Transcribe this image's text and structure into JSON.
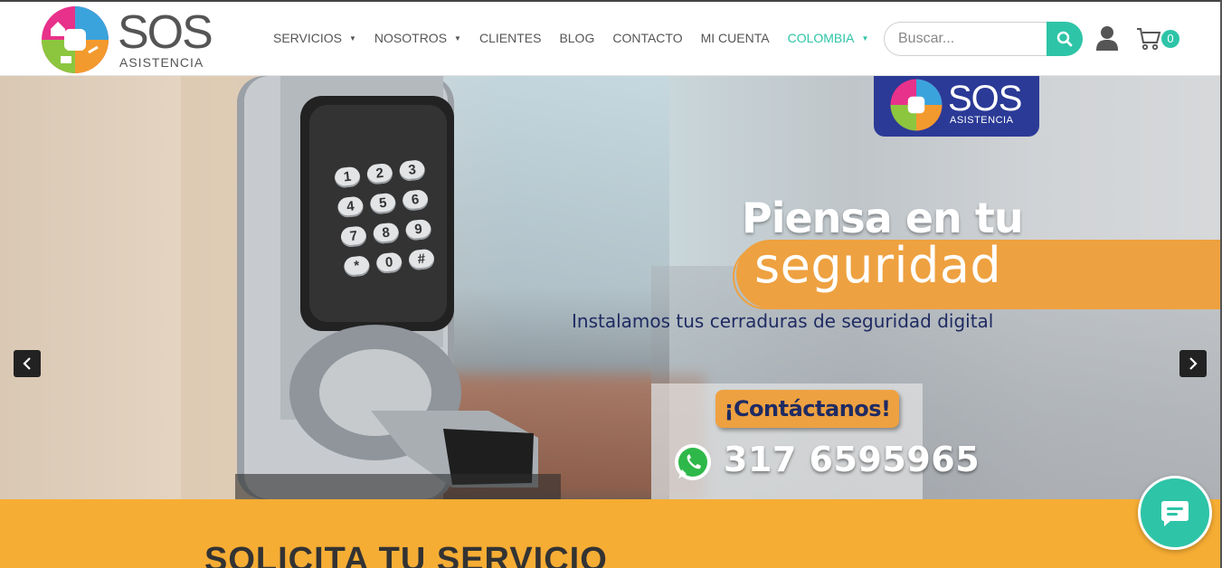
{
  "brand": {
    "name": "SOS",
    "tagline": "ASISTENCIA"
  },
  "nav": {
    "items": [
      {
        "label": "SERVICIOS",
        "has_dropdown": true
      },
      {
        "label": "NOSOTROS",
        "has_dropdown": true
      },
      {
        "label": "CLIENTES",
        "has_dropdown": false
      },
      {
        "label": "BLOG",
        "has_dropdown": false
      },
      {
        "label": "CONTACTO",
        "has_dropdown": false
      },
      {
        "label": "MI CUENTA",
        "has_dropdown": false
      },
      {
        "label": "COLOMBIA",
        "has_dropdown": true
      }
    ]
  },
  "search": {
    "placeholder": "Buscar...",
    "icon": "search-icon"
  },
  "cart": {
    "count": "0",
    "icon": "cart-icon"
  },
  "user": {
    "icon": "user-icon"
  },
  "hero": {
    "badge_name": "SOS",
    "badge_tagline": "ASISTENCIA",
    "headline_1": "Piensa en tu",
    "headline_2": "seguridad",
    "subline": "Instalamos tus cerraduras de seguridad digital",
    "cta": "¡Contáctanos!",
    "phone": "317 6595965",
    "keypad": [
      "1",
      "2",
      "3",
      "4",
      "5",
      "6",
      "7",
      "8",
      "9",
      "*",
      "0",
      "#"
    ]
  },
  "section": {
    "title": "SOLICITA TU SERVICIO"
  },
  "colors": {
    "accent_teal": "#2ec4a7",
    "orange": "#eea140",
    "section_orange": "#f6ad34",
    "navy": "#1f2b63",
    "badge_blue": "#2b3a96"
  }
}
